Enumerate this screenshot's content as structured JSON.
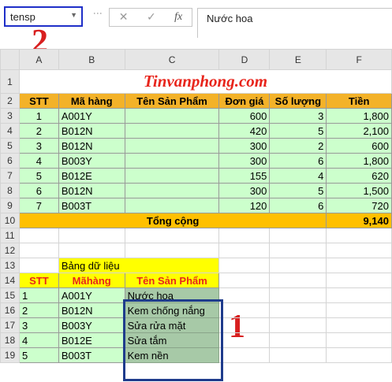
{
  "formula_bar": {
    "name_box": "tensp",
    "cancel_icon": "✕",
    "enter_icon": "✓",
    "fx_label": "fx",
    "content": "Nước hoa"
  },
  "callouts": {
    "one": "1",
    "two": "2"
  },
  "columns": [
    "A",
    "B",
    "C",
    "D",
    "E",
    "F"
  ],
  "rows": [
    "1",
    "2",
    "3",
    "4",
    "5",
    "6",
    "7",
    "8",
    "9",
    "10",
    "11",
    "12",
    "13",
    "14",
    "15",
    "16",
    "17",
    "18",
    "19"
  ],
  "title": "Tinvanphong.com",
  "main_table": {
    "headers": [
      "STT",
      "Mã hàng",
      "Tên Sản Phẩm",
      "Đơn giá",
      "Số lượng",
      "Tiền"
    ],
    "rows": [
      [
        "1",
        "A001Y",
        "",
        "600",
        "3",
        "1,800"
      ],
      [
        "2",
        "B012N",
        "",
        "420",
        "5",
        "2,100"
      ],
      [
        "3",
        "B012N",
        "",
        "300",
        "2",
        "600"
      ],
      [
        "4",
        "B003Y",
        "",
        "300",
        "6",
        "1,800"
      ],
      [
        "5",
        "B012E",
        "",
        "155",
        "4",
        "620"
      ],
      [
        "6",
        "B012N",
        "",
        "300",
        "5",
        "1,500"
      ],
      [
        "7",
        "B003T",
        "",
        "120",
        "6",
        "720"
      ]
    ],
    "total_label": "Tổng cộng",
    "total_value": "9,140"
  },
  "lookup_table": {
    "caption": "Bảng dữ liệu",
    "headers": [
      "STT",
      "Mãhàng",
      "Tên Sản Phẩm"
    ],
    "rows": [
      [
        "1",
        "A001Y",
        "Nước hoa"
      ],
      [
        "2",
        "B012N",
        "Kem chống nắng"
      ],
      [
        "3",
        "B003Y",
        "Sửa rửa mặt"
      ],
      [
        "4",
        "B012E",
        "Sửa tắm"
      ],
      [
        "5",
        "B003T",
        "Kem nền"
      ]
    ]
  }
}
